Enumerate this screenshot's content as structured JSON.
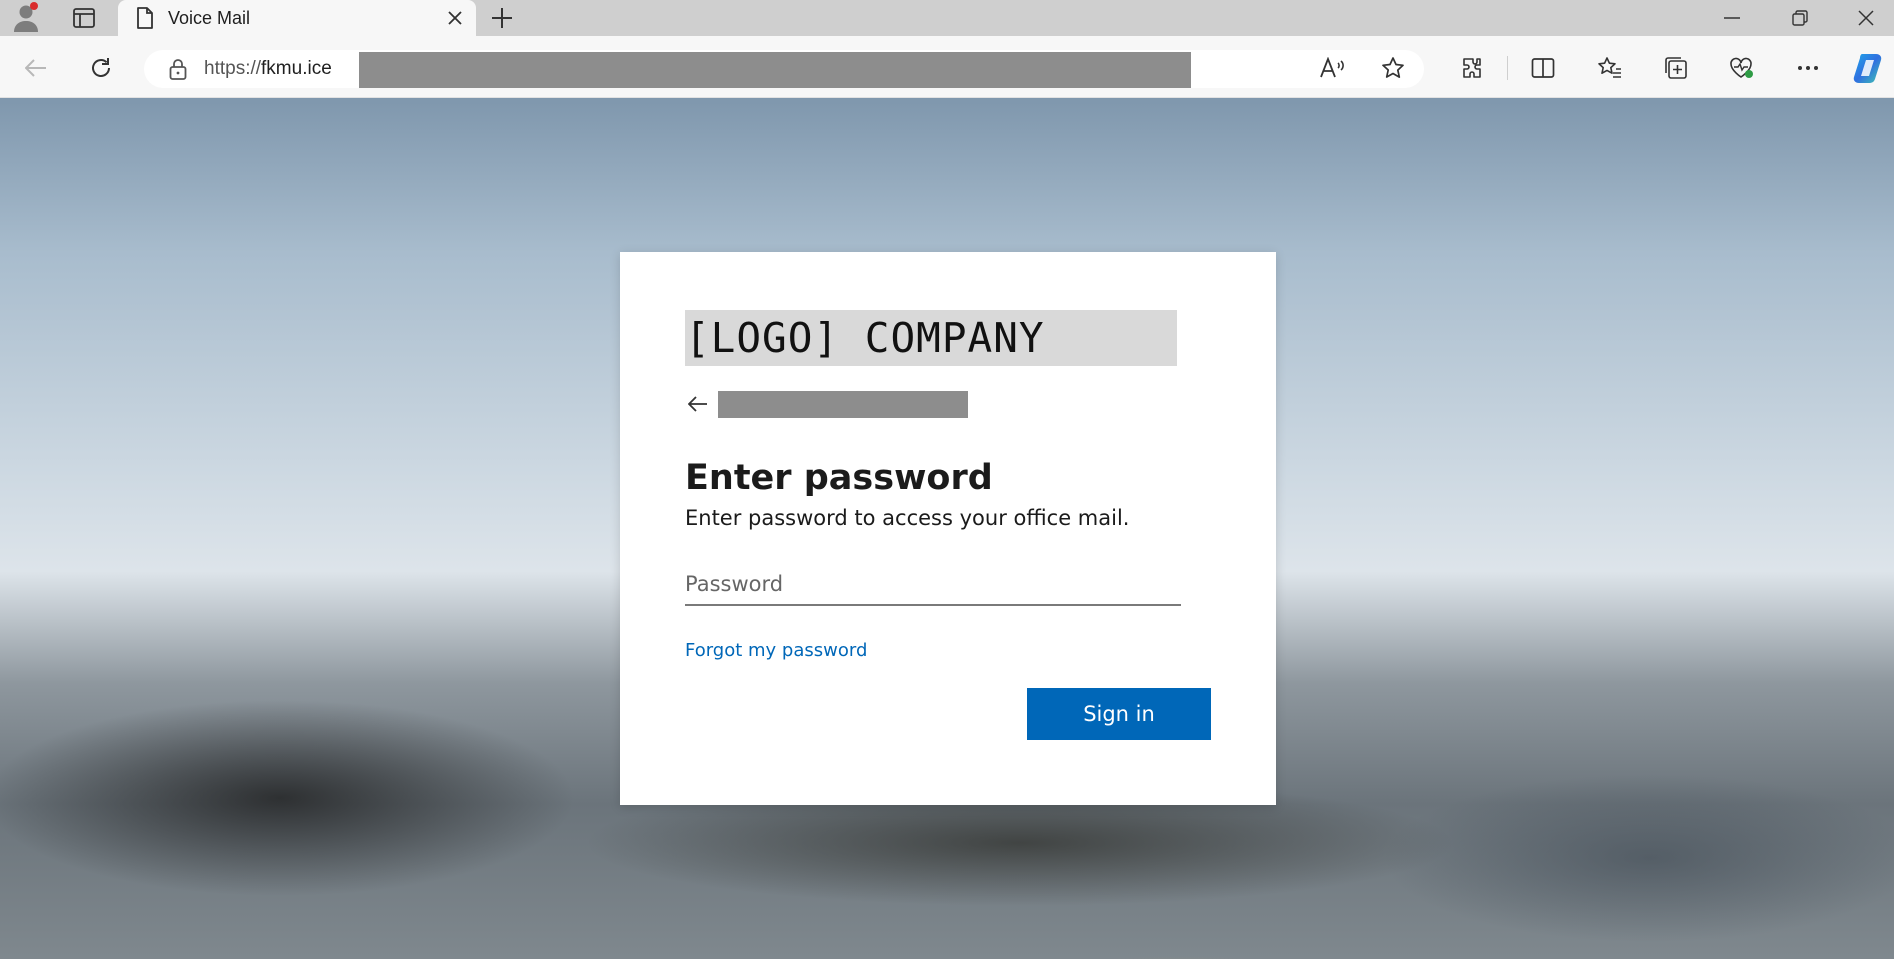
{
  "browser": {
    "tab": {
      "title": "Voice Mail",
      "close_icon": "close-icon",
      "doc_icon": "document-icon"
    },
    "address_bar": {
      "url_prefix": "https://",
      "url_host": "fkmu.ice"
    },
    "colors": {
      "accent": "#0067b8",
      "titlebar": "#cfcfcf",
      "toolbar": "#f7f7f7"
    }
  },
  "login": {
    "logo_text": "[LOGO] COMPANY",
    "heading": "Enter password",
    "subtext": "Enter password to access your office mail.",
    "password_placeholder": "Password",
    "forgot_link": "Forgot my password",
    "signin_label": "Sign in"
  }
}
